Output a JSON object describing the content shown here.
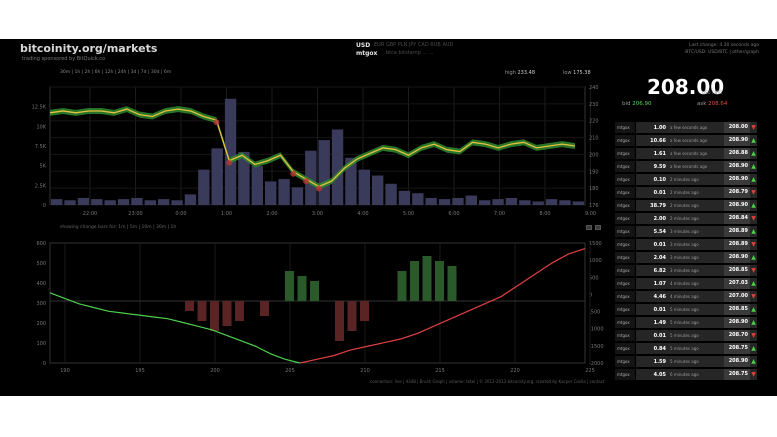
{
  "header": {
    "brand": "bitcoinity.org/markets",
    "sponsor": "trading sponsored by BitQuick.co",
    "currency_primary": "USD",
    "currency_secondary": "mtgox",
    "currency_alts": "EUR  GBP  PLN  JPY  CAD  RUB  AUD",
    "exchange_alts": "btce  bitstamp  ...  ...",
    "last_change": "Last change: 4.30 seconds ago",
    "last_change_sub": "BTC/USD: USD/BTC | other/graph"
  },
  "chart_controls": {
    "ranges": "30m | 1h | 2h | 6h | 12h | 24h | 3d | 7d | 30d | 6m",
    "high_label": "high",
    "high_value": "233.48",
    "low_label": "low",
    "low_value": "175.38",
    "volume_toggle": "showing change bars for: 1m | 5m | 10m | 30m | 1h"
  },
  "ticker": {
    "price": "208.00",
    "unit": "USD / BTC",
    "bid_label": "bid",
    "bid_value": "206.90",
    "ask_label": "ask",
    "ask_value": "208.64"
  },
  "trades": [
    {
      "exchange": "mtgox",
      "amount": "1.00",
      "ago": "a few seconds ago",
      "price": "208.00",
      "dir": "down"
    },
    {
      "exchange": "mtgox",
      "amount": "10.66",
      "ago": "a few seconds ago",
      "price": "208.90",
      "dir": "up"
    },
    {
      "exchange": "mtgox",
      "amount": "1.61",
      "ago": "a few seconds ago",
      "price": "208.88",
      "dir": "up"
    },
    {
      "exchange": "mtgox",
      "amount": "9.59",
      "ago": "a few seconds ago",
      "price": "208.90",
      "dir": "up"
    },
    {
      "exchange": "mtgox",
      "amount": "0.10",
      "ago": "2 minutes ago",
      "price": "208.90",
      "dir": "up"
    },
    {
      "exchange": "mtgox",
      "amount": "0.01",
      "ago": "2 minutes ago",
      "price": "208.79",
      "dir": "down"
    },
    {
      "exchange": "mtgox",
      "amount": "38.79",
      "ago": "2 minutes ago",
      "price": "208.90",
      "dir": "up"
    },
    {
      "exchange": "mtgox",
      "amount": "2.00",
      "ago": "2 minutes ago",
      "price": "208.84",
      "dir": "down"
    },
    {
      "exchange": "mtgox",
      "amount": "5.54",
      "ago": "3 minutes ago",
      "price": "208.89",
      "dir": "up"
    },
    {
      "exchange": "mtgox",
      "amount": "0.01",
      "ago": "3 minutes ago",
      "price": "208.89",
      "dir": "down"
    },
    {
      "exchange": "mtgox",
      "amount": "2.04",
      "ago": "3 minutes ago",
      "price": "208.90",
      "dir": "up"
    },
    {
      "exchange": "mtgox",
      "amount": "6.82",
      "ago": "3 minutes ago",
      "price": "208.85",
      "dir": "down"
    },
    {
      "exchange": "mtgox",
      "amount": "1.07",
      "ago": "4 minutes ago",
      "price": "207.03",
      "dir": "up"
    },
    {
      "exchange": "mtgox",
      "amount": "4.46",
      "ago": "4 minutes ago",
      "price": "207.00",
      "dir": "down"
    },
    {
      "exchange": "mtgox",
      "amount": "0.01",
      "ago": "5 minutes ago",
      "price": "208.85",
      "dir": "up"
    },
    {
      "exchange": "mtgox",
      "amount": "1.49",
      "ago": "5 minutes ago",
      "price": "208.90",
      "dir": "up"
    },
    {
      "exchange": "mtgox",
      "amount": "0.01",
      "ago": "5 minutes ago",
      "price": "208.70",
      "dir": "down"
    },
    {
      "exchange": "mtgox",
      "amount": "0.84",
      "ago": "5 minutes ago",
      "price": "208.75",
      "dir": "up"
    },
    {
      "exchange": "mtgox",
      "amount": "1.59",
      "ago": "5 minutes ago",
      "price": "208.90",
      "dir": "up"
    },
    {
      "exchange": "mtgox",
      "amount": "4.05",
      "ago": "6 minutes ago",
      "price": "208.75",
      "dir": "down"
    }
  ],
  "colors": {
    "up": "#4ccf4c",
    "down": "#e04040",
    "volume": "#3a3a5a",
    "price_line": "#e8c040"
  },
  "chart_data": [
    {
      "type": "line",
      "title": "",
      "xlabel": "",
      "ylabel": "",
      "x": [
        "22:00",
        "23:00",
        "0:00",
        "1:00",
        "2:00",
        "3:00",
        "4:00",
        "5:00",
        "6:00",
        "7:00",
        "8:00",
        "9:00"
      ],
      "series": [
        {
          "values": [
            226,
            227,
            226,
            227,
            227,
            226,
            228,
            225,
            224,
            227,
            228,
            227,
            224,
            222,
            200,
            203,
            198,
            200,
            203,
            194,
            190,
            186,
            189,
            196,
            201,
            204,
            207,
            206,
            203,
            207,
            209,
            206,
            205,
            210,
            209,
            207,
            209,
            210,
            207,
            208,
            209,
            208
          ]
        }
      ],
      "volume_values": [
        0.5,
        0.4,
        0.6,
        0.5,
        0.4,
        0.5,
        0.6,
        0.4,
        0.5,
        0.4,
        0.9,
        3.0,
        4.8,
        9.0,
        4.5,
        3.3,
        2.0,
        2.2,
        1.5,
        4.6,
        5.5,
        6.4,
        4.0,
        3.0,
        2.5,
        1.8,
        1.2,
        1.0,
        0.6,
        0.5,
        0.6,
        0.8,
        0.4,
        0.5,
        0.6,
        0.4,
        0.3,
        0.5,
        0.4,
        0.3
      ],
      "ylim": [
        176,
        240
      ],
      "y_ticks_left": [
        "0",
        "2.5K",
        "5K",
        "7.5K",
        "10K",
        "12.5K"
      ],
      "y_ticks_right": [
        "176",
        "180",
        "190",
        "200",
        "210",
        "220",
        "230",
        "240"
      ]
    },
    {
      "type": "area",
      "title": "",
      "x_ticks": [
        "190",
        "195",
        "200",
        "205",
        "210",
        "215",
        "220",
        "225"
      ],
      "y_ticks_left": [
        "0",
        "100",
        "200",
        "300",
        "400",
        "500",
        "600"
      ],
      "y_ticks_right": [
        "-2000",
        "-1500",
        "-1000",
        "-500",
        "0",
        "500",
        "1000",
        "1500"
      ],
      "bid_depth": [
        380,
        350,
        320,
        300,
        280,
        270,
        260,
        250,
        240,
        220,
        200,
        180,
        150,
        120,
        90,
        50,
        20,
        0
      ],
      "ask_depth": [
        0,
        20,
        40,
        70,
        90,
        110,
        130,
        160,
        200,
        240,
        280,
        320,
        360,
        420,
        480,
        540,
        590,
        620
      ],
      "change_bars": [
        0,
        0,
        -20,
        -40,
        -60,
        -50,
        -40,
        0,
        -30,
        0,
        60,
        50,
        40,
        0,
        -80,
        -60,
        -40,
        0,
        0,
        60,
        80,
        90,
        80,
        70,
        0
      ]
    }
  ]
}
